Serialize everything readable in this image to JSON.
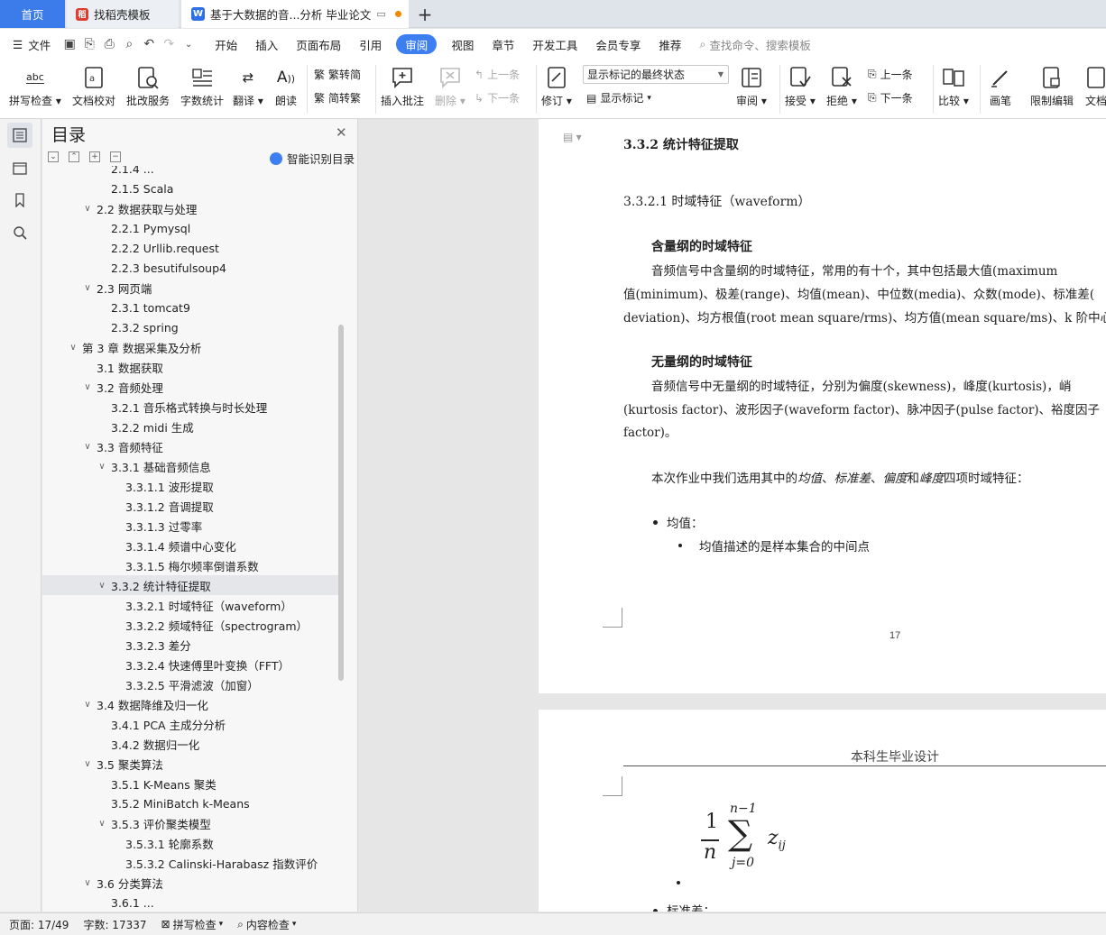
{
  "tabs": {
    "home": "首页",
    "template": "找稻壳模板",
    "document": "基于大数据的音...分析 毕业论文"
  },
  "menu": {
    "file": "文件",
    "items": [
      "开始",
      "插入",
      "页面布局",
      "引用",
      "审阅",
      "视图",
      "章节",
      "开发工具",
      "会员专享",
      "推荐"
    ],
    "active": "审阅",
    "search": "查找命令、搜索模板"
  },
  "ribbon": {
    "spell_check": "拼写检查",
    "doc_proof": "文档校对",
    "batch_service": "批改服务",
    "word_count": "字数统计",
    "translate": "翻译",
    "read_aloud": "朗读",
    "to_traditional": "繁转简",
    "to_simplified": "简转繁",
    "insert_comment": "插入批注",
    "delete": "删除",
    "prev_comment": "上一条",
    "next_comment": "下一条",
    "track_changes": "修订",
    "markup_state": "显示标记的最终状态",
    "show_markup": "显示标记",
    "review": "审阅",
    "accept": "接受",
    "reject": "拒绝",
    "prev_change": "上一条",
    "next_change": "下一条",
    "compare": "比较",
    "pen": "画笔",
    "restrict_edit": "限制编辑",
    "doc_cut": "文档"
  },
  "toc": {
    "title": "目录",
    "smart": "智能识别目录",
    "items": [
      {
        "label": "2.1.4 ...",
        "level": 2,
        "caret": false
      },
      {
        "label": "2.1.5 Scala",
        "level": 2,
        "caret": false
      },
      {
        "label": "2.2  数据获取与处理",
        "level": 1,
        "caret": true
      },
      {
        "label": "2.2.1 Pymysql",
        "level": 2,
        "caret": false
      },
      {
        "label": "2.2.2 Urllib.request",
        "level": 2,
        "caret": false
      },
      {
        "label": "2.2.3 besutifulsoup4",
        "level": 2,
        "caret": false
      },
      {
        "label": "2.3 网页端",
        "level": 1,
        "caret": true
      },
      {
        "label": "2.3.1 tomcat9",
        "level": 2,
        "caret": false
      },
      {
        "label": "2.3.2 spring",
        "level": 2,
        "caret": false
      },
      {
        "label": "第 3 章  数据采集及分析",
        "level": 0,
        "caret": true
      },
      {
        "label": "3.1  数据获取",
        "level": 1,
        "caret": false
      },
      {
        "label": "3.2  音频处理",
        "level": 1,
        "caret": true
      },
      {
        "label": "3.2.1  音乐格式转换与时长处理",
        "level": 2,
        "caret": false
      },
      {
        "label": "3.2.2 midi 生成",
        "level": 2,
        "caret": false
      },
      {
        "label": "3.3  音频特征",
        "level": 1,
        "caret": true
      },
      {
        "label": "3.3.1  基础音频信息",
        "level": 2,
        "caret": true
      },
      {
        "label": "3.3.1.1  波形提取",
        "level": 3,
        "caret": false
      },
      {
        "label": "3.3.1.2  音调提取",
        "level": 3,
        "caret": false
      },
      {
        "label": "3.3.1.3  过零率",
        "level": 3,
        "caret": false
      },
      {
        "label": "3.3.1.4  频谱中心变化",
        "level": 3,
        "caret": false
      },
      {
        "label": "3.3.1.5  梅尔频率倒谱系数",
        "level": 3,
        "caret": false
      },
      {
        "label": "3.3.2  统计特征提取",
        "level": 2,
        "caret": true,
        "selected": true
      },
      {
        "label": "3.3.2.1  时域特征（waveform）",
        "level": 3,
        "caret": false
      },
      {
        "label": "3.3.2.2  频域特征（spectrogram）",
        "level": 3,
        "caret": false
      },
      {
        "label": "3.3.2.3  差分",
        "level": 3,
        "caret": false
      },
      {
        "label": "3.3.2.4  快速傅里叶变换（FFT）",
        "level": 3,
        "caret": false
      },
      {
        "label": "3.3.2.5  平滑滤波（加窗）",
        "level": 3,
        "caret": false
      },
      {
        "label": "3.4  数据降维及归一化",
        "level": 1,
        "caret": true
      },
      {
        "label": "3.4.1 PCA 主成分分析",
        "level": 2,
        "caret": false
      },
      {
        "label": "3.4.2  数据归一化",
        "level": 2,
        "caret": false
      },
      {
        "label": "3.5  聚类算法",
        "level": 1,
        "caret": true
      },
      {
        "label": "3.5.1 K-Means 聚类",
        "level": 2,
        "caret": false
      },
      {
        "label": "3.5.2 MiniBatch k-Means",
        "level": 2,
        "caret": false
      },
      {
        "label": "3.5.3  评价聚类模型",
        "level": 2,
        "caret": true
      },
      {
        "label": "3.5.3.1  轮廓系数",
        "level": 3,
        "caret": false
      },
      {
        "label": "3.5.3.2 Calinski-Harabasz 指数评价",
        "level": 3,
        "caret": false
      },
      {
        "label": "3.6  分类算法",
        "level": 1,
        "caret": true
      },
      {
        "label": "3.6.1 ...",
        "level": 2,
        "caret": false
      }
    ]
  },
  "page1": {
    "h_332": "3.3.2  统计特征提取",
    "h_3321": "3.3.2.1  时域特征（waveform）",
    "dim_title": "含量纲的时域特征",
    "dim_line1": "音频信号中含量纲的时域特征，常用的有十个，其中包括最大值(maximum",
    "dim_line2": "值(minimum)、极差(range)、均值(mean)、中位数(media)、众数(mode)、标准差(",
    "dim_line3": "deviation)、均方根值(root mean square/rms)、均方值(mean square/ms)、k 阶中心/",
    "nodim_title": "无量纲的时域特征",
    "nodim_line1": "音频信号中无量纲的时域特征，分别为偏度(skewness)，峰度(kurtosis)，峭",
    "nodim_line2": "(kurtosis factor)、波形因子(waveform factor)、脉冲因子(pulse factor)、裕度因子",
    "nodim_line3": "factor)。",
    "choose_pre": "本次作业中我们选用其中的",
    "choose_em1": "均值",
    "choose_sep1": "、",
    "choose_em2": "标准差",
    "choose_sep2": "、",
    "choose_em3": "偏度",
    "choose_and": "和",
    "choose_em4": "峰度",
    "choose_post": "四项时域特征：",
    "bullet_mean": "均值：",
    "bullet_mean_desc": "均值描述的是样本集合的中间点",
    "page_number": "17"
  },
  "page2": {
    "header": "本科生毕业设计",
    "formula_num": "1",
    "formula_den": "n",
    "formula_sum": "∑",
    "formula_upper": "n−1",
    "formula_lower": "j=0",
    "formula_term": "z",
    "formula_sub": "ij",
    "bullet_std": "标准差："
  },
  "status": {
    "page": "页面: 17/49",
    "words": "字数: 17337",
    "spell": "拼写检查",
    "content": "内容检查"
  }
}
